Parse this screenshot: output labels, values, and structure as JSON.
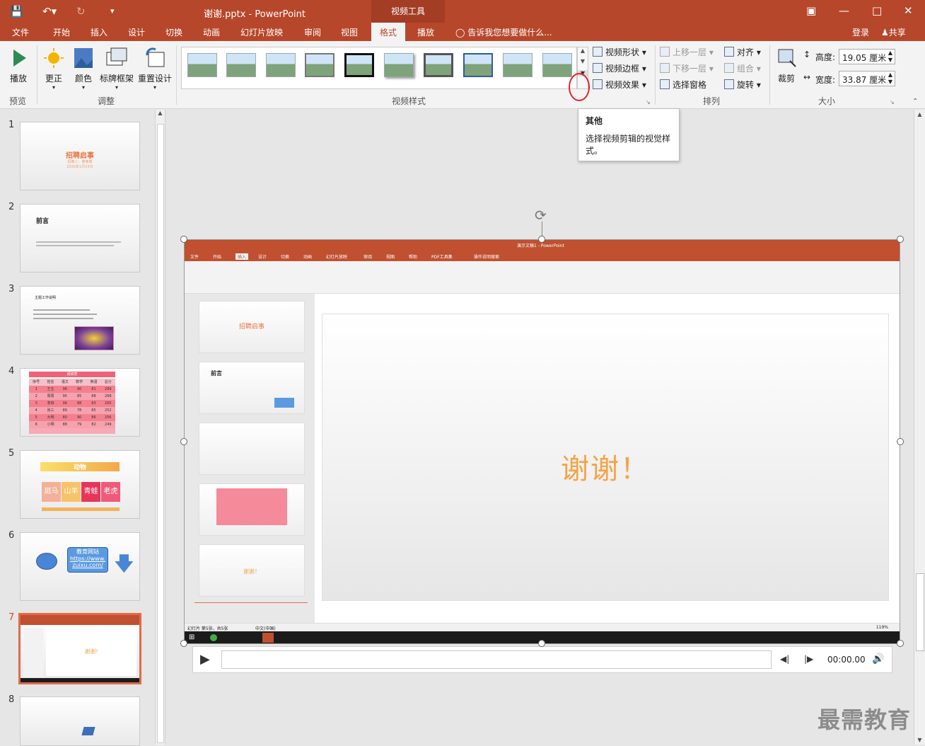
{
  "titlebar": {
    "doc_title": "谢谢.pptx - PowerPoint",
    "context_tab": "视频工具"
  },
  "tabs": [
    "文件",
    "开始",
    "插入",
    "设计",
    "切换",
    "动画",
    "幻灯片放映",
    "审阅",
    "视图",
    "格式",
    "播放"
  ],
  "active_tab": "格式",
  "tell_me": "告诉我您想要做什么...",
  "account": {
    "login": "登录",
    "share": "共享"
  },
  "ribbon": {
    "preview": {
      "play": "播放",
      "group": "预览"
    },
    "adjust": {
      "correct": "更正",
      "color": "颜色",
      "poster_frame": "标牌框架",
      "reset": "重置设计",
      "group": "调整"
    },
    "video_styles": {
      "group": "视频样式",
      "shape": "视频形状",
      "border": "视频边框",
      "effects": "视频效果"
    },
    "arrange": {
      "bring_forward": "上移一层",
      "send_backward": "下移一层",
      "selection_pane": "选择窗格",
      "align": "对齐",
      "group_btn": "组合",
      "rotate": "旋转",
      "group": "排列"
    },
    "size": {
      "crop": "裁剪",
      "height_label": "高度:",
      "height_value": "19.05 厘米",
      "width_label": "宽度:",
      "width_value": "33.87 厘米",
      "group": "大小"
    }
  },
  "tooltip": {
    "title": "其他",
    "body": "选择视频剪辑的视觉样式。"
  },
  "slides": [
    {
      "num": "1",
      "title": "招聘启事",
      "sub1": "招聘人：某某某",
      "sub2": "2020年1月15日"
    },
    {
      "num": "2",
      "title": "前言"
    },
    {
      "num": "3",
      "title": "主题工作说明"
    },
    {
      "num": "4",
      "title": "成绩表",
      "headers": [
        "序号",
        "姓名",
        "语文",
        "数学",
        "英语",
        "总分"
      ],
      "rows": [
        [
          "1",
          "王五",
          "96",
          "90",
          "81",
          "269"
        ],
        [
          "2",
          "周周",
          "95",
          "85",
          "88",
          "268"
        ],
        [
          "3",
          "李四",
          "96",
          "88",
          "83",
          "265"
        ],
        [
          "4",
          "张三",
          "89",
          "78",
          "85",
          "252"
        ],
        [
          "5",
          "大明",
          "80",
          "90",
          "86",
          "256"
        ],
        [
          "6",
          "小明",
          "88",
          "79",
          "82",
          "249"
        ]
      ]
    },
    {
      "num": "5",
      "title": "动物",
      "cells": [
        "斑马",
        "山羊",
        "青蛙",
        "老虎"
      ]
    },
    {
      "num": "6",
      "box_title": "教育网站",
      "link1": "https://www.",
      "link2": "zuixu.com/"
    },
    {
      "num": "7",
      "title": "谢谢!"
    },
    {
      "num": "8"
    }
  ],
  "video": {
    "title": "谢谢！",
    "inner_title": "演示文稿1 - PowerPoint",
    "inner_tabs": [
      "文件",
      "开始",
      "插入",
      "设计",
      "切换",
      "动画",
      "幻灯片放映",
      "审阅",
      "视图",
      "帮助",
      "PDF工具集",
      "操作说明搜索"
    ],
    "inner_slides": [
      "招聘启事",
      "前言",
      "",
      "",
      "谢谢！"
    ],
    "status": "幻灯片 第5张，共5张",
    "lang": "中文(中国)",
    "zoom": "119%"
  },
  "player": {
    "time": "00:00.00"
  },
  "watermark": "最需教育",
  "colors": {
    "accent": "#b7472a",
    "tab_text_active": "#b7472a",
    "slide_orange": "#f0a850"
  }
}
